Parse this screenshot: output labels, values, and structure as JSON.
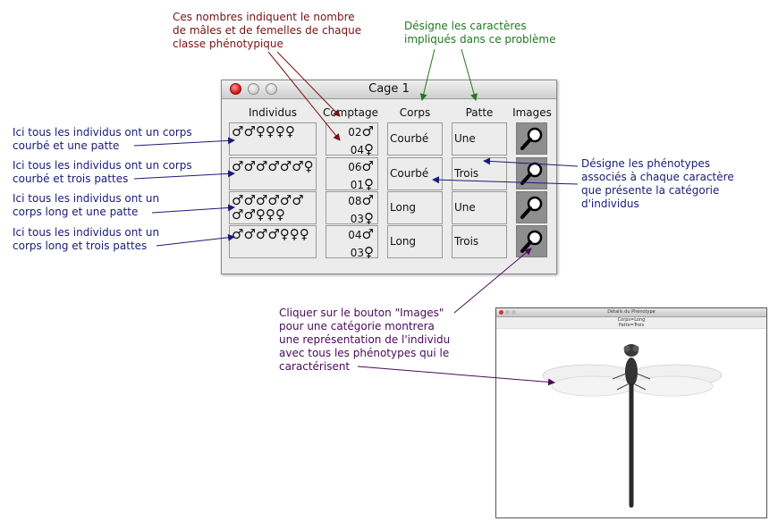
{
  "annotations": {
    "top_maroon": [
      "Ces nombres indiquent le nombre",
      "de mâles et de femelles de chaque",
      "classe phénotypique"
    ],
    "top_green": [
      "Désigne les caractères",
      "impliqués dans ce problème"
    ],
    "left_1": [
      "Ici tous les individus ont un corps",
      "courbé et une patte"
    ],
    "left_2": [
      "Ici tous les individus ont un corps",
      "courbé et trois pattes"
    ],
    "left_3": [
      "Ici tous les individus ont un",
      "corps long et une patte"
    ],
    "left_4": [
      "Ici tous les individus ont un",
      "corps long et trois pattes"
    ],
    "right_phen": [
      "Désigne les phénotypes",
      "associés à chaque caractère",
      "que présente la catégorie",
      "d'individus"
    ],
    "bottom_purple": [
      "Cliquer sur le bouton \"Images\"",
      "pour une catégorie montrera",
      "une représentation de l'individu",
      "avec tous les phénotypes qui le",
      "caractérisent"
    ]
  },
  "cage_window": {
    "title": "Cage  1",
    "headers": {
      "individus": "Individus",
      "comptage": "Comptage",
      "corps": "Corps",
      "patte": "Patte",
      "images": "Images"
    },
    "rows": [
      {
        "individus": "♂♂♀♀♀♀",
        "males": "02",
        "females": "04",
        "corps": "Courbé",
        "patte": "Une"
      },
      {
        "individus": "♂♂♂♂♂♂♀",
        "males": "06",
        "females": "01",
        "corps": "Courbé",
        "patte": "Trois"
      },
      {
        "individus": "♂♂♂♂♂♂♂♂♀♀♀",
        "males": "08",
        "females": "03",
        "corps": "Long",
        "patte": "Une"
      },
      {
        "individus": "♂♂♂♂♀♀♀",
        "males": "04",
        "females": "03",
        "corps": "Long",
        "patte": "Trois"
      }
    ],
    "male_symbol": "♂",
    "female_symbol": "♀",
    "image_button_icon": "magnifier-icon"
  },
  "photo_window": {
    "title": "Détails du Phénotype",
    "info_line1": "Corps=Long",
    "info_line2": "Patte=Trois"
  },
  "colors": {
    "navy": "#1a1a7a",
    "maroon": "#7a1212",
    "green": "#1f7a1f",
    "purple": "#4a0a5a"
  }
}
